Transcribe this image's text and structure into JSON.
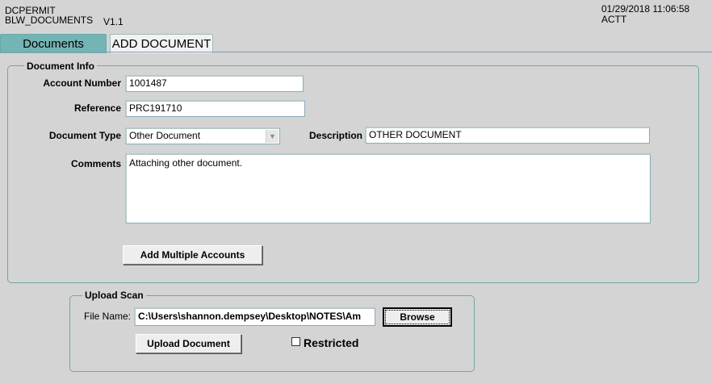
{
  "header": {
    "app_code": "DCPERMIT",
    "form_name": "BLW_DOCUMENTS",
    "version": "V1.1",
    "datetime": "01/29/2018 11:06:58",
    "mode": "ACTT"
  },
  "tabs": [
    {
      "label": "Documents",
      "active": false
    },
    {
      "label": "ADD DOCUMENT",
      "active": true
    }
  ],
  "document_info": {
    "legend": "Document Info",
    "account_number_label": "Account Number",
    "account_number": "1001487",
    "reference_label": "Reference",
    "reference": "PRC191710",
    "document_type_label": "Document Type",
    "document_type": "Other Document",
    "description_label": "Description",
    "description": "OTHER DOCUMENT",
    "comments_label": "Comments",
    "comments": "Attaching other document.",
    "add_multiple_label": "Add Multiple Accounts"
  },
  "upload_scan": {
    "legend": "Upload Scan",
    "file_name_label": "File Name:",
    "file_name": "C:\\Users\\shannon.dempsey\\Desktop\\NOTES\\Am",
    "browse_label": "Browse",
    "upload_label": "Upload Document",
    "restricted_label": "Restricted",
    "restricted": false
  },
  "colors": {
    "background": "#d4d4d4",
    "tab_inactive": "#74b4b4",
    "group_border": "#6fa7a7"
  }
}
